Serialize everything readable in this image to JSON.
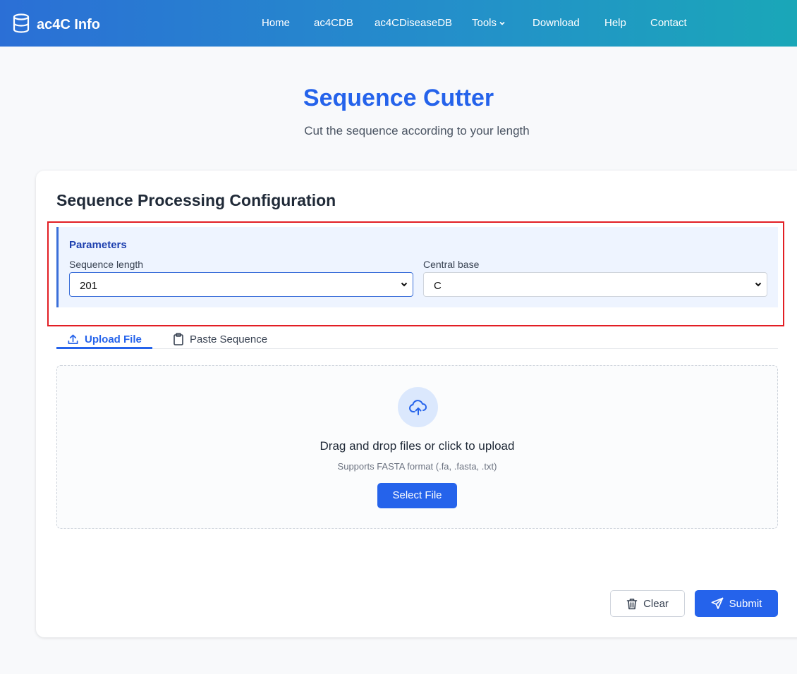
{
  "navbar": {
    "brand": "ac4C Info",
    "items": [
      {
        "label": "Home"
      },
      {
        "label": "ac4CDB"
      },
      {
        "label": "ac4CDiseaseDB"
      },
      {
        "label": "Tools"
      },
      {
        "label": "Download"
      },
      {
        "label": "Help"
      },
      {
        "label": "Contact"
      }
    ]
  },
  "hero": {
    "title": "Sequence Cutter",
    "subtitle": "Cut the sequence according to your length"
  },
  "card": {
    "title": "Sequence Processing Configuration",
    "parameters": {
      "title": "Parameters",
      "sequence_length": {
        "label": "Sequence length",
        "value": "201"
      },
      "central_base": {
        "label": "Central base",
        "value": "C"
      }
    },
    "tabs": [
      {
        "label": "Upload File",
        "active": true
      },
      {
        "label": "Paste Sequence",
        "active": false
      }
    ],
    "dropzone": {
      "title": "Drag and drop files or click to upload",
      "subtitle": "Supports FASTA format (.fa, .fasta, .txt)",
      "button": "Select File"
    },
    "actions": {
      "clear": "Clear",
      "submit": "Submit"
    }
  },
  "colors": {
    "accent": "#2563eb",
    "highlight_border": "#e21e24",
    "params_bg": "#eef4ff"
  }
}
